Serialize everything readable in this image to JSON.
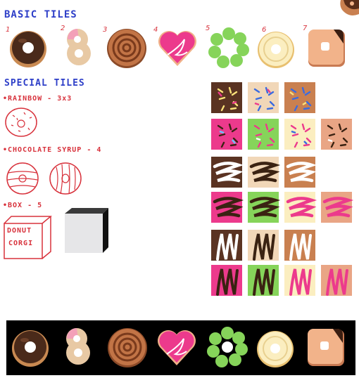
{
  "headings": {
    "basic": "BASIC TILES",
    "special": "SPECIAL TILES",
    "rainbow": "•RAINBOW - 3x3",
    "chocolate": "•CHOCOLATE SYRUP - 4",
    "box": "•BOX - 5"
  },
  "tile_numbers": [
    "1",
    "2",
    "3",
    "4",
    "5",
    "6",
    "7"
  ],
  "box_sketch_text": [
    "DONUT",
    "CORGI"
  ],
  "colors": {
    "ink_blue": "#2e3fc8",
    "ink_red": "#d8323c",
    "chocolate": "#4a2a1a",
    "pink": "#ec3a8c",
    "green": "#86d45a",
    "cream": "#fbeec0",
    "caramel": "#c98050",
    "tan": "#e8c9a4",
    "peach": "#e9a585"
  }
}
